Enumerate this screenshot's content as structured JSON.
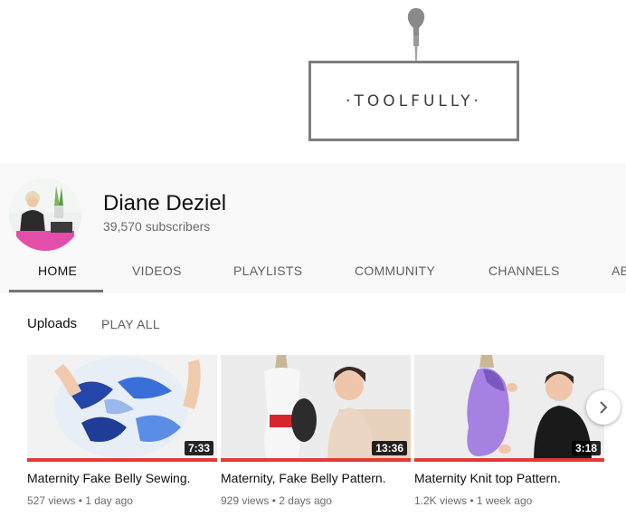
{
  "banner": {
    "logo_text": "·TOOLFULLY·"
  },
  "channel": {
    "name": "Diane Deziel",
    "subscribers": "39,570 subscribers"
  },
  "tabs": [
    {
      "label": "HOME",
      "active": true
    },
    {
      "label": "VIDEOS"
    },
    {
      "label": "PLAYLISTS"
    },
    {
      "label": "COMMUNITY"
    },
    {
      "label": "CHANNELS"
    },
    {
      "label": "AB"
    }
  ],
  "uploads": {
    "title": "Uploads",
    "play_all": "PLAY ALL",
    "videos": [
      {
        "title": "Maternity Fake Belly Sewing.",
        "duration": "7:33",
        "views": "527 views",
        "age": "1 day ago",
        "progress": 1.0
      },
      {
        "title": "Maternity, Fake Belly Pattern.",
        "duration": "13:36",
        "views": "929 views",
        "age": "2 days ago",
        "progress": 1.0
      },
      {
        "title": "Maternity Knit top Pattern.",
        "duration": "3:18",
        "views": "1.2K views",
        "age": "1 week ago",
        "progress": 1.0
      }
    ]
  },
  "icons": {
    "next": "chevron-right-icon",
    "logo": "awl-pin-icon"
  },
  "colors": {
    "accent_red": "#e53935",
    "text": "#0f0f0f",
    "muted": "#606060"
  }
}
